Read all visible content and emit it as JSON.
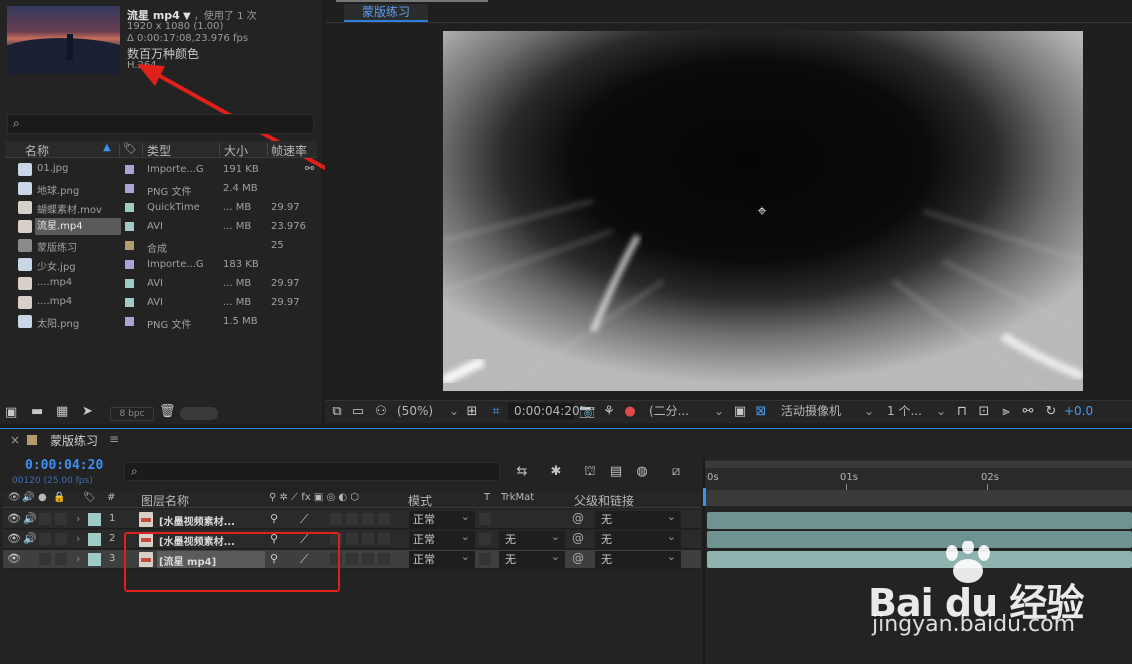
{
  "project": {
    "footage_name": "流星 mp4",
    "footage_used": "，使用了 1 次",
    "footage_dims": "1920 x 1080 (1.00)",
    "footage_duration": "Δ 0:00:17:08,23.976 fps",
    "footage_colors": "数百万种颜色",
    "footage_codec": "H.264",
    "columns": {
      "name": "名称",
      "type": "类型",
      "size": "大小",
      "rate": "帧速率"
    },
    "files": [
      {
        "name": "01.jpg",
        "type": "Importe...G",
        "size": "191 KB",
        "rate": "",
        "chip": "#a9a6d6",
        "icon": "image"
      },
      {
        "name": "地球.png",
        "type": "PNG 文件",
        "size": "2.4 MB",
        "rate": "",
        "chip": "#a9a6d6",
        "icon": "image"
      },
      {
        "name": "蝴蝶素材.mov",
        "type": "QuickTime",
        "size": "... MB",
        "rate": "29.97",
        "chip": "#9ecbc3",
        "icon": "video"
      },
      {
        "name": "流星.mp4",
        "type": "AVI",
        "size": "... MB",
        "rate": "23.976",
        "chip": "#9ecbc3",
        "icon": "video"
      },
      {
        "name": "蒙版练习",
        "type": "合成",
        "size": "",
        "rate": "25",
        "chip": "#b39b6e",
        "icon": "comp"
      },
      {
        "name": "少女.jpg",
        "type": "Importe...G",
        "size": "183 KB",
        "rate": "",
        "chip": "#a9a6d6",
        "icon": "image"
      },
      {
        "name": "....mp4",
        "type": "AVI",
        "size": "... MB",
        "rate": "29.97",
        "chip": "#9ecbc3",
        "icon": "video"
      },
      {
        "name": "....mp4",
        "type": "AVI",
        "size": "... MB",
        "rate": "29.97",
        "chip": "#9ecbc3",
        "icon": "video"
      },
      {
        "name": "太阳.png",
        "type": "PNG 文件",
        "size": "1.5 MB",
        "rate": "",
        "chip": "#a9a6d6",
        "icon": "image"
      }
    ],
    "bpc": "8 bpc"
  },
  "viewer": {
    "tab": "蒙版练习",
    "zoom": "(50%)",
    "timecode": "0:00:04:20",
    "resolution": "(二分...",
    "camera": "活动摄像机",
    "views": "1 个...",
    "exposure": "+0.0"
  },
  "timeline": {
    "close": "×",
    "title": "蒙版练习",
    "menu": "≡",
    "timecode": "0:00:04:20",
    "frames": "00120 (25.00 fps)",
    "headers": {
      "hash": "#",
      "layer_name": "图层名称",
      "mode": "模式",
      "t": "T",
      "trkmat": "TrkMat",
      "parent": "父级和链接"
    },
    "ruler": [
      "0s",
      "01s",
      "02s"
    ],
    "layers": [
      {
        "num": "1",
        "name": "[水墨视频素材...",
        "mode": "正常",
        "trkmat": "",
        "parent": "无"
      },
      {
        "num": "2",
        "name": "[水墨视频素材...",
        "mode": "正常",
        "trkmat": "无",
        "parent": "无"
      },
      {
        "num": "3",
        "name": "[流星 mp4]",
        "mode": "正常",
        "trkmat": "无",
        "parent": "无"
      }
    ]
  },
  "watermark": {
    "logo": "Bai du 经验",
    "url": "jingyan.baidu.com"
  },
  "colors": {
    "accent": "#2f7fe0",
    "highlight": "#e0201a",
    "layer_label": "#9ecbc3"
  }
}
